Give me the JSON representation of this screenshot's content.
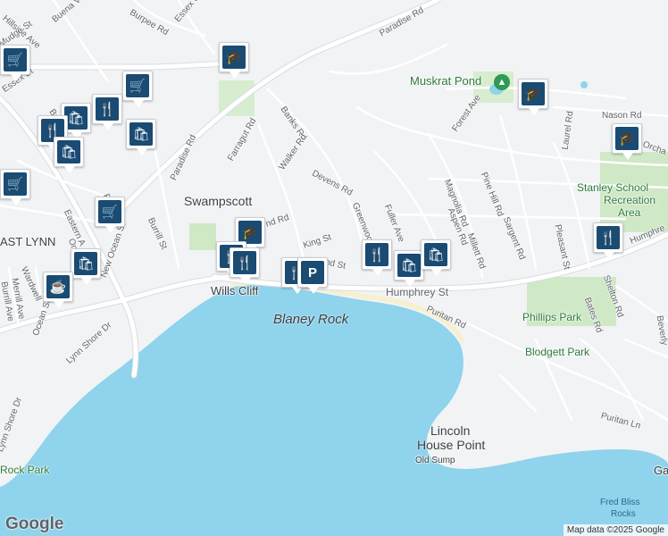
{
  "map": {
    "colors": {
      "land": "#f2f3f5",
      "water": "#8fd3ec",
      "road": "#ffffff",
      "road_outline": "#dadce0",
      "park": "#cfe8c6",
      "pin": "#1a4b73"
    },
    "places": {
      "swampscott": "Swampscott",
      "east_lynn": "AST LYNN",
      "wills_cliff": "Wills Cliff",
      "blaney_rock": "Blaney Rock",
      "lincoln_house_point_1": "Lincoln",
      "lincoln_house_point_2": "House Point",
      "old_sump": "Old Sump",
      "fred_bliss_1": "Fred Bliss",
      "fred_bliss_2": "Rocks",
      "muskrat_pond": "Muskrat Pond",
      "stanley_1": "Stanley School",
      "stanley_2": "Recreation",
      "stanley_3": "Area",
      "phillips_park": "Phillips Park",
      "blodgett_park": "Blodgett Park",
      "rock_park": "Rock Park",
      "gallo": "Ga"
    },
    "streets": {
      "hillside_ave": "Hillside Ave",
      "buena_vista": "Buena Vis",
      "burpee_rd": "Burpee Rd",
      "essex_st_top": "Essex St",
      "paradise_rd_top": "Paradise Rd",
      "mudge_st": "Mudge St",
      "essex_st_left": "Essex St",
      "beach": "Beach",
      "banks_rd": "Banks Rd",
      "farragut_rd": "Farragut Rd",
      "walker_rd": "Walker Rd",
      "devens_rd": "Devens Rd",
      "paradise_rd_mid": "Paradise Rd",
      "greenwood_ave": "Greenwood A",
      "fuller_ave": "Fuller Ave",
      "forest_ave": "Forest Ave",
      "magnolia_rd": "Magnolia Rd",
      "pine_hill_rd": "Pine Hill Rd",
      "aspen_rd": "Aspen Rd",
      "millett_rd": "Millett Rd",
      "sargent_rd": "Sargent Rd",
      "laurel_rd": "Laurel Rd",
      "nason_rd": "Nason Rd",
      "orchard": "Orcha",
      "pleasant_st": "Pleasant St",
      "humphrey_st_right": "Humphre",
      "shelton_rd": "Shelton Rd",
      "bates_rd": "Bates Rd",
      "beverly": "Beverly",
      "humphrey_st": "Humphrey St",
      "puritan_rd": "Puritan Rd",
      "puritan_ln": "Puritan Ln",
      "burrill_st": "Burrill St",
      "new_ocean_st": "New Ocean St",
      "eastern_a": "Eastern A",
      "wardwell": "Wardwell",
      "merrill_ave": "Merrill Ave",
      "burrill_ave": "Burrill Ave",
      "ocean_st": "Ocean St",
      "lynn_shore_dr": "Lynn Shore Dr",
      "lynn_shore_dr_2": "Lynn Shore Dr",
      "king_st": "King St",
      "nd_rd": "nd Rd",
      "nd_st": "nd St",
      "on": "On",
      "p": "P"
    },
    "pins": [
      {
        "type": "school-icon"
      },
      {
        "type": "grocery-icon"
      },
      {
        "type": "restaurant-icon"
      },
      {
        "type": "shopping-icon"
      },
      {
        "type": "restaurant-icon"
      },
      {
        "type": "shopping-icon"
      },
      {
        "type": "shopping-icon"
      },
      {
        "type": "grocery-icon"
      },
      {
        "type": "grocery-icon"
      },
      {
        "type": "school-icon"
      },
      {
        "type": "restaurant-icon"
      },
      {
        "type": "restaurant-icon"
      },
      {
        "type": "restaurant-icon"
      },
      {
        "type": "parking-icon"
      },
      {
        "type": "restaurant-icon"
      },
      {
        "type": "shopping-icon"
      },
      {
        "type": "shopping-icon"
      },
      {
        "type": "shopping-icon"
      },
      {
        "type": "cafe-icon"
      },
      {
        "type": "school-icon"
      },
      {
        "type": "school-icon"
      },
      {
        "type": "restaurant-icon"
      },
      {
        "type": "grocery-icon"
      }
    ],
    "logo": "Google",
    "attribution": "Map data ©2025 Google"
  }
}
